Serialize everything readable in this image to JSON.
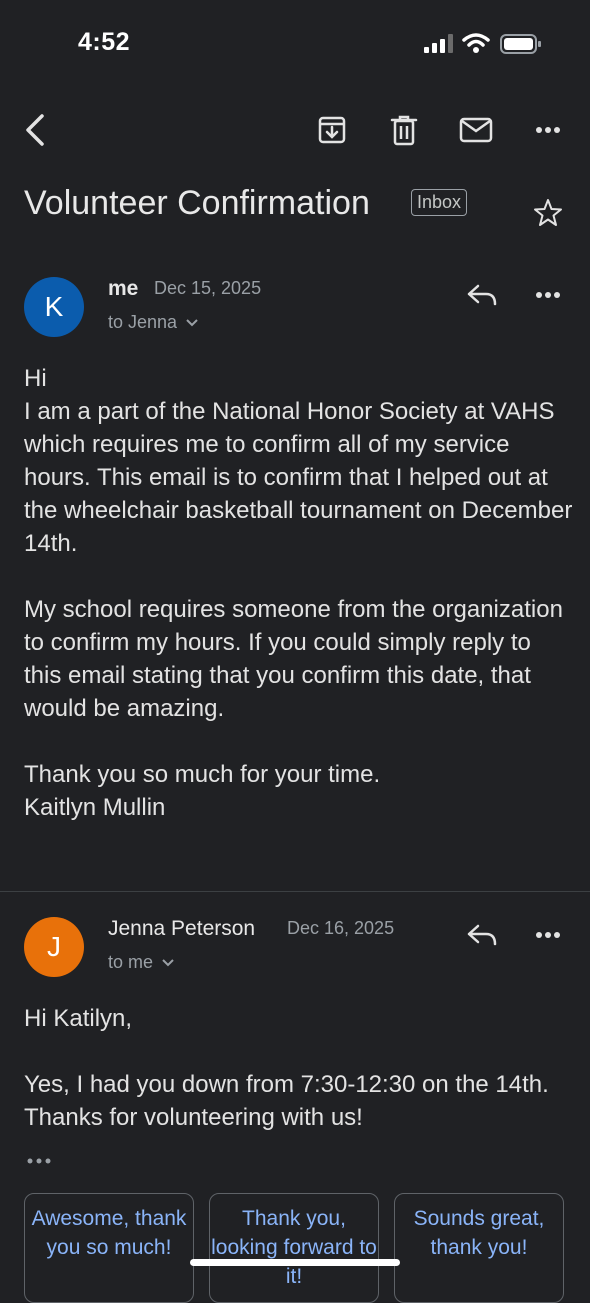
{
  "status_bar": {
    "time": "4:52"
  },
  "email": {
    "subject": "Volunteer Confirmation",
    "label": "Inbox",
    "messages": [
      {
        "avatar_letter": "K",
        "avatar_color": "#0b5cad",
        "sender": "me",
        "date": "Dec 15, 2025",
        "recipient": "to Jenna",
        "body": "Hi\nI am a part of the National Honor Society at VAHS which requires me to confirm all of my service hours. This email is to confirm that I helped out at the wheelchair basketball tournament on December 14th.\n\nMy school requires someone from the organization to confirm my hours. If you could simply reply to this email stating that you confirm this date, that would be amazing.\n\nThank you so much for your time.\nKaitlyn Mullin"
      },
      {
        "avatar_letter": "J",
        "avatar_color": "#e8710a",
        "sender": "Jenna Peterson",
        "date": "Dec 16, 2025",
        "recipient": "to me",
        "body": "Hi Katilyn,\n\nYes, I had you down from 7:30-12:30 on the 14th. Thanks for volunteering with us!"
      }
    ]
  },
  "smart_replies": [
    "Awesome, thank you so much!",
    "Thank you, looking forward to it!",
    "Sounds great, thank you!"
  ],
  "icons": [
    "back-icon",
    "archive-icon",
    "delete-icon",
    "mark-unread-icon",
    "more-icon",
    "star-icon",
    "reply-icon",
    "signal-icon",
    "wifi-icon",
    "battery-icon"
  ]
}
